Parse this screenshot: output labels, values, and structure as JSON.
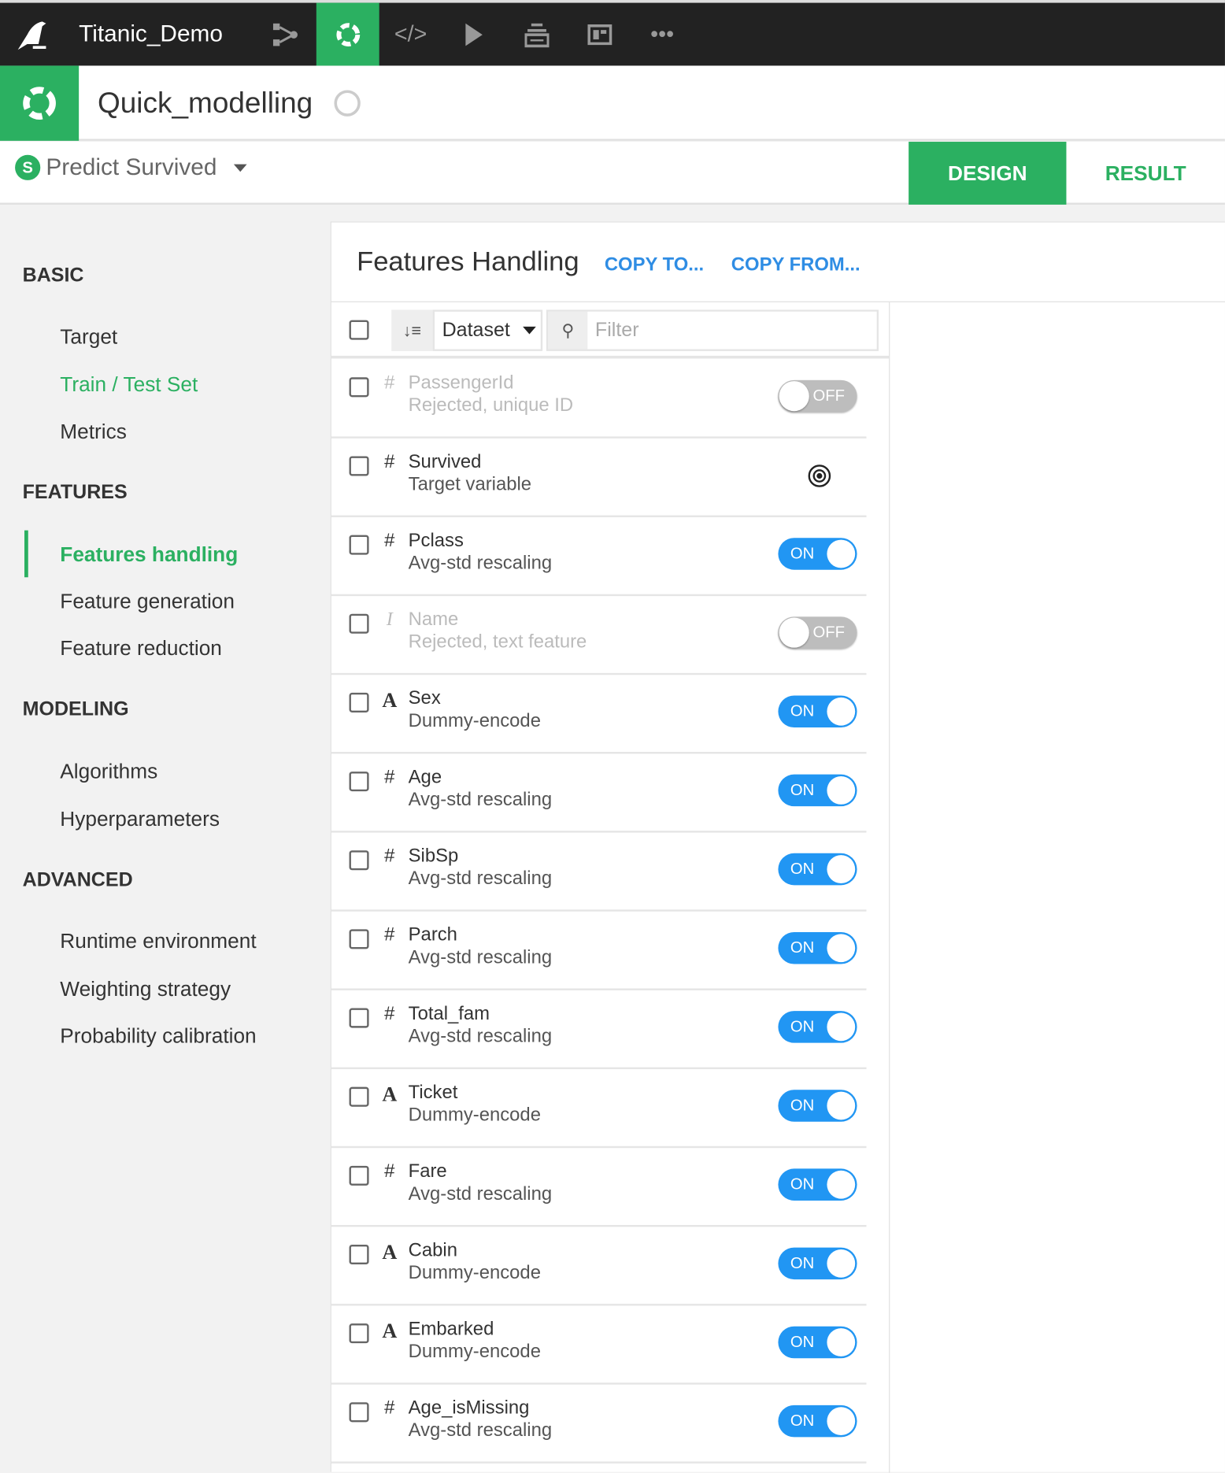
{
  "topbar": {
    "project": "Titanic_Demo",
    "icons": [
      "bird-logo-icon",
      "flow-icon",
      "lab-icon",
      "code-icon",
      "run-icon",
      "stack-icon",
      "dashboard-icon",
      "more-icon"
    ]
  },
  "analysis": {
    "title": "Quick_modelling"
  },
  "model": {
    "name": "Predict Survived",
    "tabs": {
      "design": "DESIGN",
      "result": "RESULT"
    }
  },
  "sidebar": {
    "sections": [
      {
        "title": "BASIC",
        "items": [
          "Target",
          "Train / Test Set",
          "Metrics"
        ]
      },
      {
        "title": "FEATURES",
        "items": [
          "Features handling",
          "Feature generation",
          "Feature reduction"
        ]
      },
      {
        "title": "MODELING",
        "items": [
          "Algorithms",
          "Hyperparameters"
        ]
      },
      {
        "title": "ADVANCED",
        "items": [
          "Runtime environment",
          "Weighting strategy",
          "Probability calibration"
        ]
      }
    ],
    "active": "Features handling"
  },
  "panel": {
    "title": "Features Handling",
    "copy_to": "COPY TO...",
    "copy_from": "COPY FROM...",
    "toolbar": {
      "sort": "Dataset",
      "filter_placeholder": "Filter"
    },
    "features": [
      {
        "type": "#",
        "name": "PassengerId",
        "handling": "Rejected, unique ID",
        "state": "OFF"
      },
      {
        "type": "#",
        "name": "Survived",
        "handling": "Target variable",
        "state": "target"
      },
      {
        "type": "#",
        "name": "Pclass",
        "handling": "Avg-std rescaling",
        "state": "ON"
      },
      {
        "type": "I",
        "name": "Name",
        "handling": "Rejected, text feature",
        "state": "OFF"
      },
      {
        "type": "A",
        "name": "Sex",
        "handling": "Dummy-encode",
        "state": "ON"
      },
      {
        "type": "#",
        "name": "Age",
        "handling": "Avg-std rescaling",
        "state": "ON"
      },
      {
        "type": "#",
        "name": "SibSp",
        "handling": "Avg-std rescaling",
        "state": "ON"
      },
      {
        "type": "#",
        "name": "Parch",
        "handling": "Avg-std rescaling",
        "state": "ON"
      },
      {
        "type": "#",
        "name": "Total_fam",
        "handling": "Avg-std rescaling",
        "state": "ON"
      },
      {
        "type": "A",
        "name": "Ticket",
        "handling": "Dummy-encode",
        "state": "ON"
      },
      {
        "type": "#",
        "name": "Fare",
        "handling": "Avg-std rescaling",
        "state": "ON"
      },
      {
        "type": "A",
        "name": "Cabin",
        "handling": "Dummy-encode",
        "state": "ON"
      },
      {
        "type": "A",
        "name": "Embarked",
        "handling": "Dummy-encode",
        "state": "ON"
      },
      {
        "type": "#",
        "name": "Age_isMissing",
        "handling": "Avg-std rescaling",
        "state": "ON"
      }
    ]
  },
  "colors": {
    "green": "#2bb061",
    "blue": "#2196f3",
    "topbar": "#222222"
  }
}
